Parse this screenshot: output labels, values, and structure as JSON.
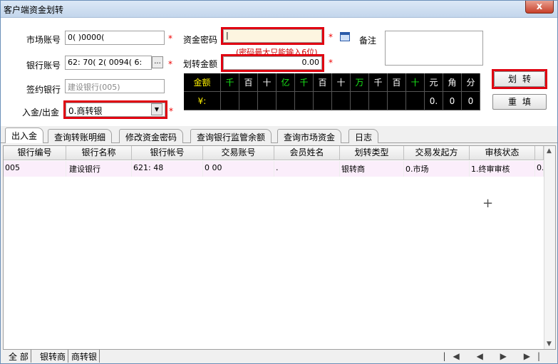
{
  "window": {
    "title": "客户端资金划转",
    "close_glyph": "x"
  },
  "form": {
    "market_account": {
      "label": "市场账号",
      "value": "0( )0000( "
    },
    "bank_account": {
      "label": "银行账号",
      "value": "62: 70( 2( 0094( 6: ",
      "browse_label": "..."
    },
    "sign_bank": {
      "label": "签约银行",
      "value": "建设银行(005)"
    },
    "direction": {
      "label": "入金/出金",
      "value": "0.商转银",
      "arrow": "▼"
    },
    "fund_password": {
      "label": "资金密码",
      "value": "|",
      "hint": "(密码最大只能输入6位)"
    },
    "transfer_amount": {
      "label": "划转金额",
      "value": "0.00"
    },
    "remark": {
      "label": "备注",
      "value": ""
    },
    "required_mark": "*",
    "amount_grid": {
      "header_label": "金额",
      "units": [
        "千",
        "百",
        "十",
        "亿",
        "千",
        "百",
        "十",
        "万",
        "千",
        "百",
        "十",
        "元",
        "角",
        "分"
      ],
      "green_units": [
        0,
        3,
        7,
        10
      ],
      "row_label": "¥:",
      "digits": [
        "",
        "",
        "",
        "",
        "",
        "",
        "",
        "",
        "",
        "",
        "",
        "0.",
        "0",
        "0"
      ]
    },
    "buttons": {
      "transfer": "划转",
      "reset": "重填"
    }
  },
  "tabs": [
    "出入金",
    "查询转账明细",
    "修改资金密码",
    "查询银行监管余额",
    "查询市场资金",
    "日志"
  ],
  "table": {
    "columns": [
      "银行编号",
      "银行名称",
      "银行帐号",
      "交易账号",
      "会员姓名",
      "划转类型",
      "交易发起方",
      "审核状态"
    ],
    "rows": [
      [
        "005",
        "建设银行",
        "621:           48",
        "0              00",
        ".             ",
        "银转商",
        "0.市场",
        "1.终审审核",
        "0."
      ]
    ]
  },
  "bottom_tabs": [
    "全 部",
    "银转商",
    "商转银"
  ],
  "pager": [
    "|◀",
    "◀",
    "▶",
    "▶|"
  ]
}
